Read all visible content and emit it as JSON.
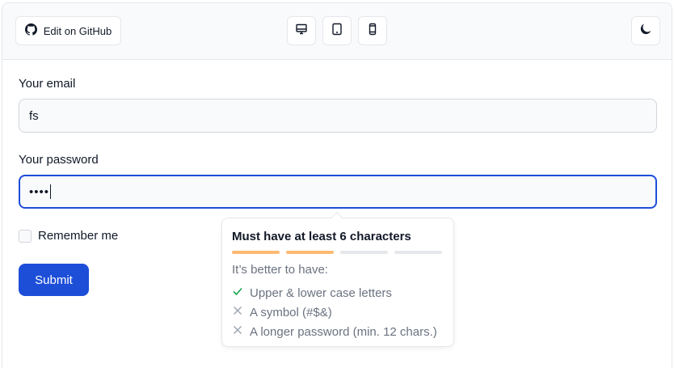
{
  "toolbar": {
    "github_label": "Edit on GitHub",
    "device_buttons": [
      "desktop-icon",
      "tablet-icon",
      "mobile-icon"
    ],
    "theme_icon": "moon-icon"
  },
  "form": {
    "email_label": "Your email",
    "email_value": "fs",
    "password_label": "Your password",
    "password_value": "••••",
    "remember_label": "Remember me",
    "submit_label": "Submit"
  },
  "popover": {
    "title": "Must have at least 6 characters",
    "strength_filled": 2,
    "strength_total": 4,
    "subtitle": "It’s better to have:",
    "requirements": [
      {
        "label": "Upper & lower case letters",
        "met": true
      },
      {
        "label": "A symbol (#$&)",
        "met": false
      },
      {
        "label": "A longer password (min. 12 chars.)",
        "met": false
      }
    ]
  },
  "colors": {
    "accent": "#1d4ed8",
    "strength_fill": "#fdba74",
    "met_check": "#16a34a"
  }
}
